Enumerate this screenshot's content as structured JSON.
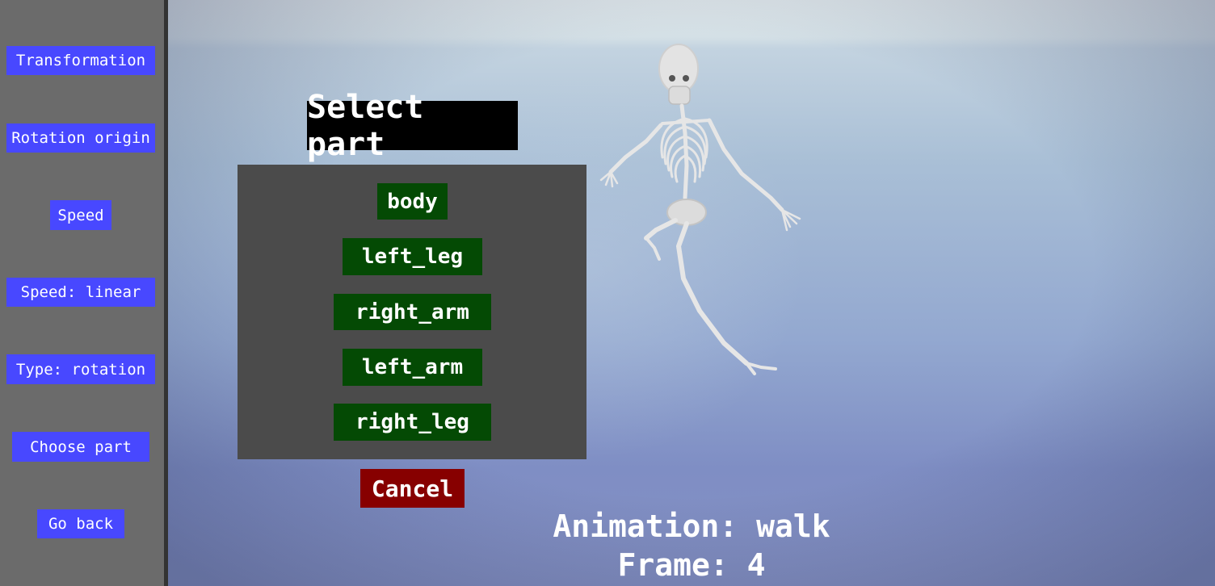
{
  "sidebar": {
    "buttons": [
      {
        "label": "Transformation"
      },
      {
        "label": "Rotation origin"
      },
      {
        "label": "Speed"
      },
      {
        "label": "Speed: linear"
      },
      {
        "label": "Type: rotation"
      },
      {
        "label": "Choose part"
      },
      {
        "label": "Go back"
      }
    ]
  },
  "dialog": {
    "title": "Select part",
    "parts": [
      "body",
      "left_leg",
      "right_arm",
      "left_arm",
      "right_leg"
    ],
    "cancel_label": "Cancel"
  },
  "status": {
    "animation": "Animation: walk",
    "frame": "Frame: 4"
  },
  "colors": {
    "sidebar_button": "#4848ff",
    "part_button": "#044a04",
    "cancel_button": "#870000",
    "panel": "#4b4b4b"
  }
}
